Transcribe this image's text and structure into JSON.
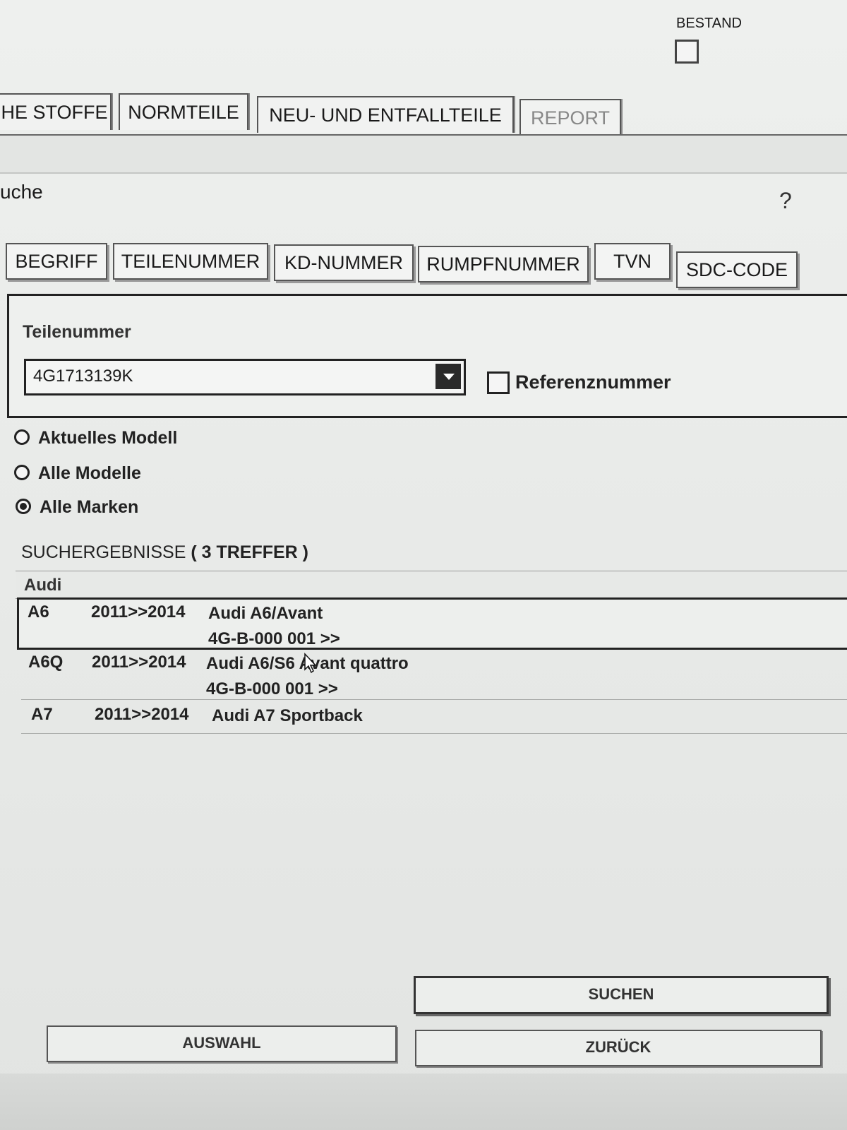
{
  "header": {
    "bestand_label": "BESTAND"
  },
  "top_tabs": [
    {
      "label": "HE STOFFE"
    },
    {
      "label": "NORMTEILE"
    },
    {
      "label": "NEU- UND ENTFALLTEILE"
    },
    {
      "label": "REPORT"
    }
  ],
  "section": {
    "title": "uche",
    "help": "?"
  },
  "search_tabs": [
    {
      "label": "BEGRIFF"
    },
    {
      "label": "TEILENUMMER"
    },
    {
      "label": "KD-NUMMER"
    },
    {
      "label": "RUMPFNUMMER"
    },
    {
      "label": "TVN"
    },
    {
      "label": "SDC-CODE"
    }
  ],
  "search": {
    "field_label": "Teilenummer",
    "value": "4G1713139K",
    "reference_label": "Referenznummer"
  },
  "scope": [
    {
      "label": "Aktuelles Modell",
      "selected": false
    },
    {
      "label": "Alle Modelle",
      "selected": false
    },
    {
      "label": "Alle Marken",
      "selected": true
    }
  ],
  "results": {
    "title": "SUCHERGEBNISSE",
    "count": "( 3 TREFFER )",
    "group": "Audi",
    "rows": [
      {
        "model": "A6",
        "years": "2011>>2014",
        "desc": "Audi A6/Avant",
        "sub": "4G-B-000 001 >>"
      },
      {
        "model": "A6Q",
        "years": "2011>>2014",
        "desc": "Audi A6/S6 Avant quattro",
        "sub": "4G-B-000 001 >>"
      },
      {
        "model": "A7",
        "years": "2011>>2014",
        "desc": "Audi A7 Sportback",
        "sub": ""
      }
    ]
  },
  "buttons": {
    "suchen": "SUCHEN",
    "auswahl": "AUSWAHL",
    "zurueck": "ZURÜCK"
  }
}
